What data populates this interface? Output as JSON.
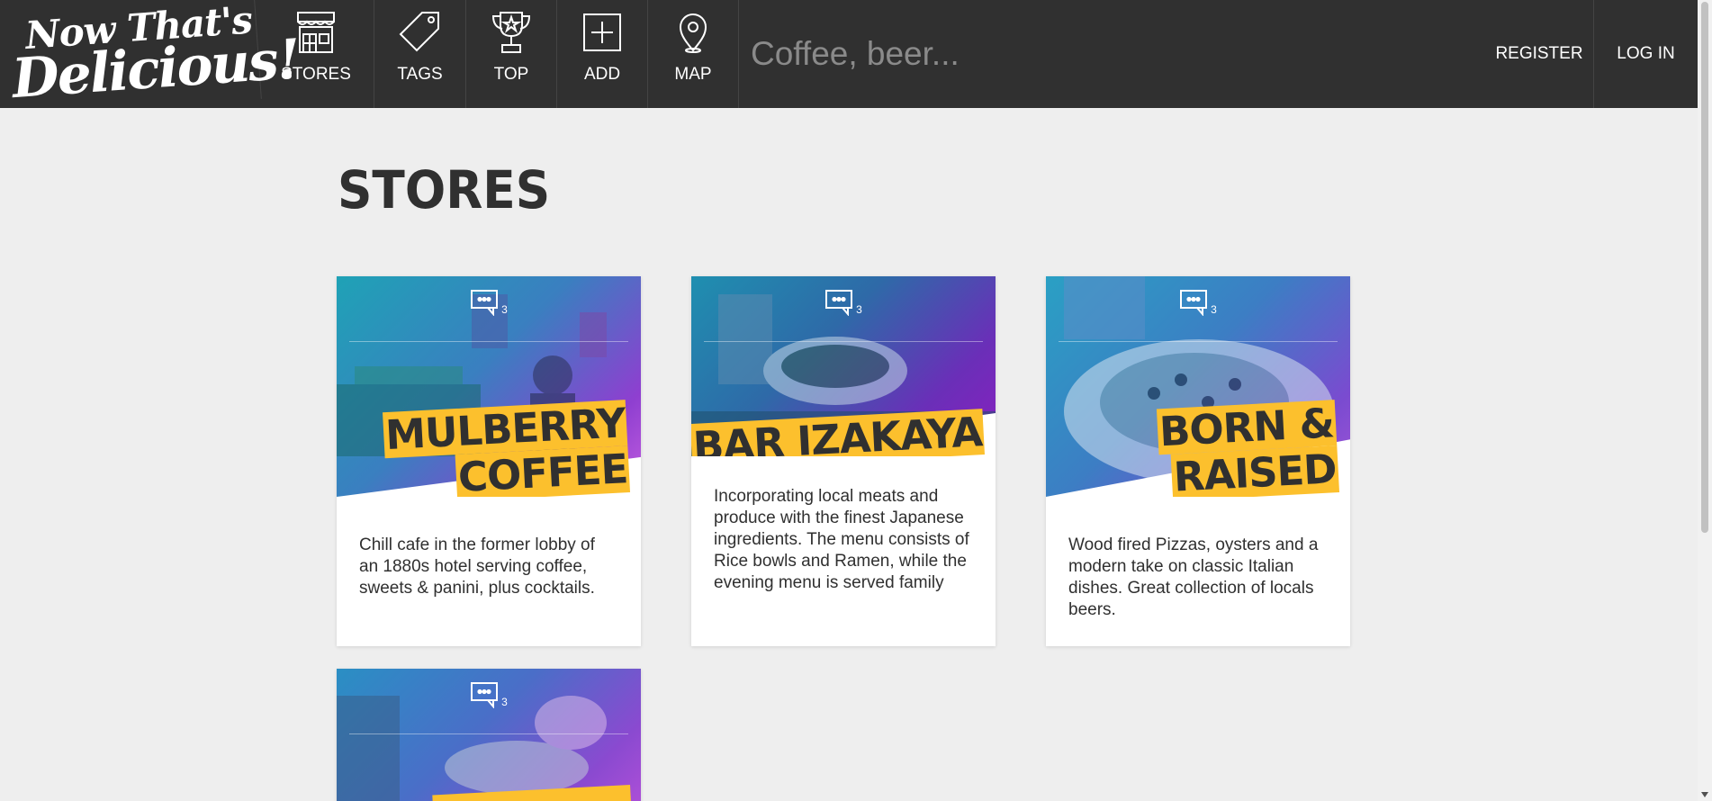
{
  "app": {
    "logo_line1": "Now That's",
    "logo_line2": "Delicious!"
  },
  "nav": {
    "stores": "STORES",
    "tags": "TAGS",
    "top": "TOP",
    "add": "ADD",
    "map": "MAP"
  },
  "search": {
    "placeholder": "Coffee, beer..."
  },
  "auth": {
    "register": "REGISTER",
    "login": "LOG IN"
  },
  "main": {
    "title": "STORES"
  },
  "colors": {
    "header_bg": "#303030",
    "highlight": "#fcc02d",
    "gradient_start": "#1fa2b6",
    "gradient_end": "#8e24c6"
  },
  "stores": [
    {
      "name_line1": "MULBERRY",
      "name_line2": "COFFEE",
      "comments": "3",
      "description": "Chill cafe in the former lobby of an 1880s hotel serving coffee, sweets & panini, plus cocktails."
    },
    {
      "name_line1": "BAR IZAKAYA",
      "name_line2": "",
      "comments": "3",
      "description": "Incorporating local meats and produce with the finest Japanese ingredients. The menu consists of Rice bowls and Ramen, while the evening menu is served family"
    },
    {
      "name_line1": "BORN &",
      "name_line2": "RAISED",
      "comments": "3",
      "description": "Wood fired Pizzas, oysters and a modern take on classic Italian dishes. Great collection of locals beers."
    },
    {
      "name_line1": "",
      "name_line2": "",
      "comments": "3",
      "description": ""
    }
  ]
}
